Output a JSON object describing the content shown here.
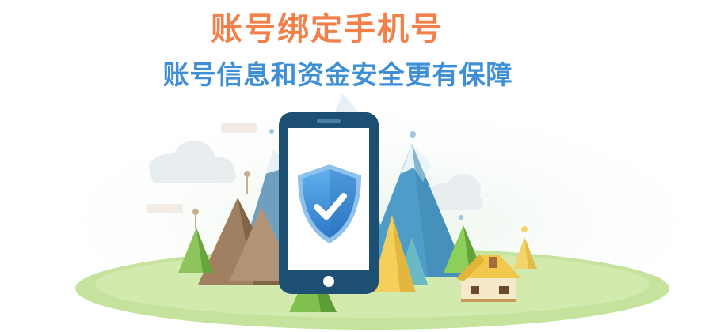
{
  "header": {
    "title": "账号绑定手机号",
    "subtitle": "账号信息和资金安全更有保障"
  },
  "colors": {
    "title": "#f1804b",
    "subtitle": "#3f8fd6",
    "phone_frame": "#1d4f72",
    "shield": "#3f8fd6"
  },
  "icons": {
    "phone": "phone-icon",
    "shield": "shield-check-icon"
  }
}
